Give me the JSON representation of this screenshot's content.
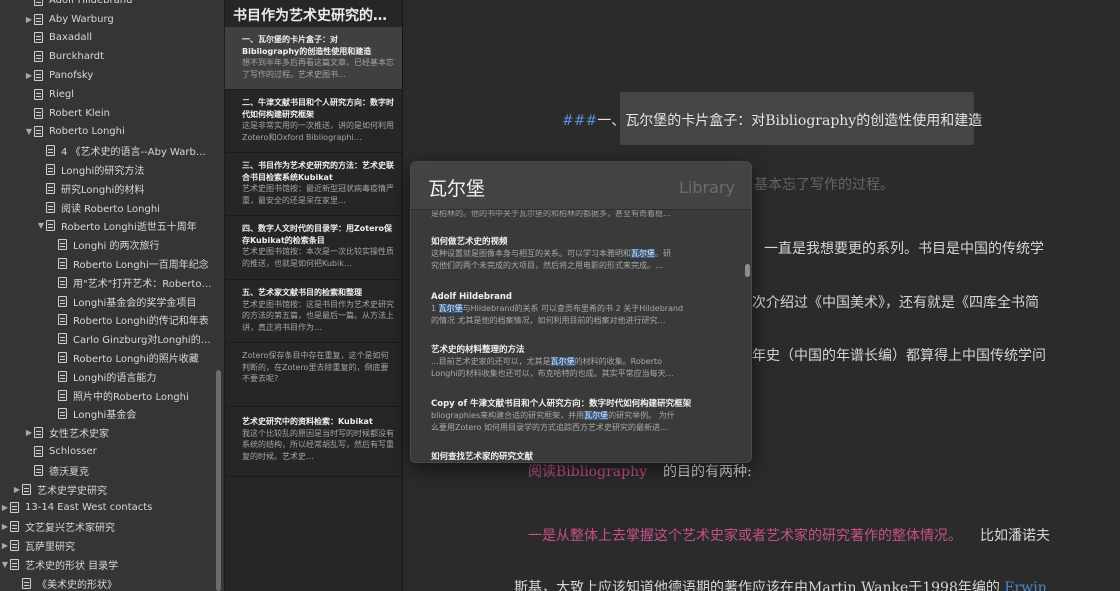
{
  "sidebar": {
    "items": [
      {
        "label": "Adolf Hildebrand",
        "expand": ""
      },
      {
        "label": "Aby Warburg",
        "expand": "▶"
      },
      {
        "label": "Baxadall",
        "expand": ""
      },
      {
        "label": "Burckhardt",
        "expand": ""
      },
      {
        "label": "Panofsky",
        "expand": "▶"
      },
      {
        "label": "Riegl",
        "expand": ""
      },
      {
        "label": "Robert Klein",
        "expand": ""
      },
      {
        "label": "Roberto Longhi",
        "expand": "▼"
      },
      {
        "label": "4 《艺术史的语言--Aby Warbur…",
        "expand": ""
      },
      {
        "label": "Longhi的研究方法",
        "expand": ""
      },
      {
        "label": "研究Longhi的材料",
        "expand": ""
      },
      {
        "label": "阅读 Roberto Longhi",
        "expand": ""
      },
      {
        "label": "Roberto Longhi逝世五十周年",
        "expand": "▼"
      },
      {
        "label": "Longhi 的两次旅行",
        "expand": ""
      },
      {
        "label": "Roberto Longhi一百周年纪念",
        "expand": ""
      },
      {
        "label": "用\"艺术\"打开艺术：Roberto…",
        "expand": ""
      },
      {
        "label": "Longhi基金会的奖学金项目",
        "expand": ""
      },
      {
        "label": "Roberto Longhi的传记和年表",
        "expand": ""
      },
      {
        "label": "Carlo Ginzburg对Longhi的…",
        "expand": ""
      },
      {
        "label": "Roberto Longhi的照片收藏",
        "expand": ""
      },
      {
        "label": "Longhi的语言能力",
        "expand": ""
      },
      {
        "label": "照片中的Roberto Longhi",
        "expand": ""
      },
      {
        "label": "Longhi基金会",
        "expand": ""
      },
      {
        "label": "女性艺术史家",
        "expand": "▶"
      },
      {
        "label": "Schlosser",
        "expand": ""
      },
      {
        "label": "德沃夏克",
        "expand": ""
      },
      {
        "label": "艺术史学史研究",
        "expand": "▶"
      },
      {
        "label": "13-14 East West contacts",
        "expand": "▶"
      },
      {
        "label": "文艺复兴艺术家研究",
        "expand": "▶"
      },
      {
        "label": "瓦萨里研究",
        "expand": "▶"
      },
      {
        "label": "艺术史的形状   目录学",
        "expand": "▼"
      },
      {
        "label": "《美术史的形状》",
        "expand": ""
      }
    ]
  },
  "notelist": {
    "title": "书目作为艺术史研究的…",
    "notes": [
      {
        "title": "一、瓦尔堡的卡片盒子：对Bibliography的创造性使用和建造",
        "snippet": "想不到半年多后再看这篇文章，已经基本忘了写作的过程。艺术史图书…"
      },
      {
        "title": "二、牛津文献书目和个人研究方向：数字时代如何构建研究框架",
        "snippet": "这是非常实用的一次推送，讲的是如何利用Zotero和Oxford Bibliographi…"
      },
      {
        "title": "三、书目作为艺术史研究的方法：艺术史联合书目检索系统Kubikat",
        "snippet": "艺术史图书馆按：最近新型冠状病毒疫情严重，最安全的还是呆在家里…"
      },
      {
        "title": "四、数字人文时代的目录学：用Zotero保存Kubikat的检索条目",
        "snippet": "艺术史图书馆按：本次是一次比较实操性质的推送，也就是如何把Kubik…"
      },
      {
        "title": "五、艺术家文献书目的检索和整理",
        "snippet": "艺术史图书馆按：这是书目作为艺术史研究的方法的第五篇，也是最后一篇。从方法上讲，真正将书目作为…"
      },
      {
        "title": "",
        "snippet": "Zotero保存条目中存在重复，这个是如何判断的，在Zotero里去除重复的，倒底要不要去呢?"
      },
      {
        "title": "艺术史研究中的资料检索：Kubikat",
        "snippet": "我这个比较乱的原因是当时写的时候都没有系统的结构，所以经常胡乱写，然后有写重复的时候。艺术史…"
      }
    ]
  },
  "editor": {
    "heading_marker": "###",
    "heading_text": "一、瓦尔堡的卡片盒子：对Bibliography的创造性使用和建造",
    "line_faint": "基本忘了写作的过程。",
    "line1": "一直是我想要更的系列。书目是中国的传统学",
    "line2": "次介绍过《中国美术》，还有就是《四库全书简",
    "line3": "年史（中国的年谱长编）都算得上中国传统学问",
    "line4_link": "阅读Bibliography",
    "line4_rest": "的目的有两种:",
    "line5_pink": "一是从整体上去掌握这个艺术史家或者艺术家的研究著作的整体情况。",
    "line5_rest": "比如潘诺夫",
    "line6": "斯基，大致上应该知道他德语期的著作应该在由Martin Wanke于1998年编的",
    "line6_link": "Erwin"
  },
  "search": {
    "query": "瓦尔堡",
    "scope": "Library",
    "cut_line": "是柏林的。他的书中关于瓦尔堡的和柏林的都据多，甚至有奇着稳…",
    "results": [
      {
        "title": "如何做艺术史的视频",
        "l1a": "这种设置就是图像本身与相互的关系。可以学习本雅明和",
        "l1h": "瓦尔堡",
        "l1b": "。研",
        "l2a": "究他们的两个未完成的大项目，然后将之用电影的形式来完成。…",
        "l2h": "",
        "l2b": ""
      },
      {
        "title": "Adolf Hildebrand",
        "l1a": "1 ",
        "l1h": "瓦尔堡",
        "l1b": "与Hildebrand的关系 可以查贡布里希的书 2 关于Hildebrand",
        "l2a": "的情况 尤其是他的档案情况，如何利用目前的档案对他进行研究…",
        "l2h": "",
        "l2b": ""
      },
      {
        "title": "艺术史的材料整理的方法",
        "l1a": "...目前艺术史家的还可以，尤其是",
        "l1h": "瓦尔堡",
        "l1b": "的材料的收集。Roberto",
        "l2a": "Longhi的材料收集也还可以，布克哈特的也成。其实平常应当每天…",
        "l2h": "",
        "l2b": ""
      },
      {
        "title": "Copy of 牛津文献书目和个人研究方向：数字时代如何构建研究框架",
        "l1a": "bliographies来构建合适的研究框架，并用",
        "l1h": "瓦尔堡",
        "l1b": "的研究举例。 为什",
        "l2a": "么要用Zotero 如何用目录学的方式追踪西方艺术史研究的最新进…",
        "l2h": "",
        "l2b": ""
      },
      {
        "title": "如何查找艺术家的研究文献",
        "l1a": "",
        "l1h": "",
        "l1b": "",
        "l2a": "",
        "l2h": "",
        "l2b": ""
      }
    ]
  },
  "colors": {
    "accent_link": "#c74f8e",
    "heading_marker": "#5b8ed8",
    "highlight": "#375a85"
  }
}
